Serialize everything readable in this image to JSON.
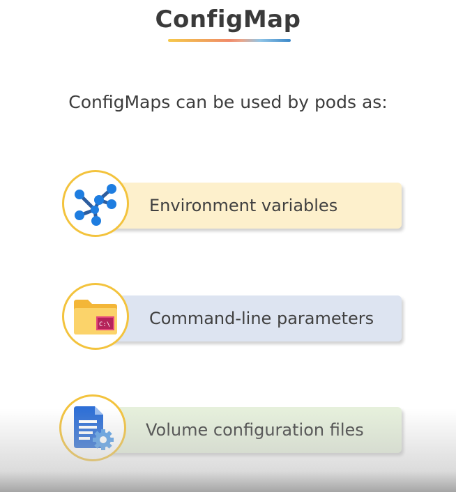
{
  "title": "ConfigMap",
  "subtitle": "ConfigMaps can be used by pods as:",
  "items": [
    {
      "label": "Environment variables",
      "icon": "network-nodes-icon",
      "color": "#fdf0cc"
    },
    {
      "label": "Command-line parameters",
      "icon": "folder-terminal-icon",
      "color": "#dde4f1"
    },
    {
      "label": "Volume configuration files",
      "icon": "document-gear-icon",
      "color": "#e6f0dc"
    }
  ],
  "colors": {
    "accent_yellow": "#f3c33d",
    "title_text": "#3a3a3a",
    "body_text": "#404040"
  }
}
